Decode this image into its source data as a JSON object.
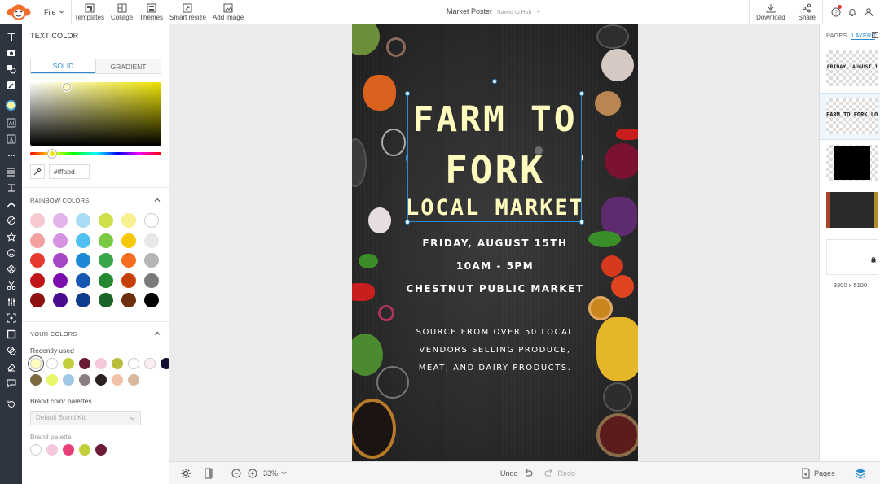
{
  "app": {
    "file_menu": "File",
    "toolbar": [
      {
        "name": "templates",
        "label": "Templates"
      },
      {
        "name": "collage",
        "label": "Collage"
      },
      {
        "name": "themes",
        "label": "Themes"
      },
      {
        "name": "smart-resize",
        "label": "Smart resize"
      },
      {
        "name": "add-image",
        "label": "Add image"
      }
    ],
    "doc_title": "Market Poster",
    "save_status": "Saved to Hub",
    "download_label": "Download",
    "share_label": "Share"
  },
  "color_panel": {
    "title": "TEXT COLOR",
    "tabs": [
      "SOLID",
      "GRADIENT"
    ],
    "active_tab": "SOLID",
    "hex_value": "#fffabd",
    "rainbow_title": "RAINBOW COLORS",
    "rainbow_colors": [
      "#f8c8d0",
      "#e4b2ea",
      "#a9dcf5",
      "#cfe04a",
      "#f6f08f",
      "#ffffff",
      "#f2a0a0",
      "#d393e0",
      "#4fc0f0",
      "#7ac943",
      "#f5c800",
      "#e8e8e8",
      "#e63b2e",
      "#a648c6",
      "#1e88d8",
      "#3aa64a",
      "#f56d20",
      "#b5b5b5",
      "#c0161a",
      "#7a0dab",
      "#1757b2",
      "#23882f",
      "#c44008",
      "#7a7a7a",
      "#8c1212",
      "#4a0b8e",
      "#0f3c8c",
      "#1a6428",
      "#6e2d0c",
      "#000000"
    ],
    "your_colors_title": "YOUR COLORS",
    "recently_used_label": "Recently used",
    "recent_colors": [
      "#fffabd",
      "#ffffff",
      "#c2cf3a",
      "#6b1b33",
      "#f5c6dc",
      "#b8bd3b",
      "#ffffff",
      "#fdeef6",
      "#101030",
      "#7a6a3e",
      "#e9f56a",
      "#9fc8e6",
      "#8c7e80",
      "#2a2220",
      "#f3c0a8",
      "#d8b9a0"
    ],
    "brand_palettes_label": "Brand color palettes",
    "brand_kit_placeholder": "Default Brand Kit",
    "brand_palette_label": "Brand palette",
    "brand_colors": [
      "#ffffff",
      "#f5c6dc",
      "#e83e7a",
      "#c2cf3a",
      "#6b1b33"
    ]
  },
  "poster": {
    "title_line1": "FARM TO",
    "title_line2": "FORK",
    "title_line3": "LOCAL MARKET",
    "date": "FRIDAY, AUGUST 15TH",
    "time": "10AM - 5PM",
    "venue": "CHESTNUT PUBLIC MARKET",
    "desc_line1": "SOURCE FROM OVER 50 LOCAL",
    "desc_line2": "VENDORS SELLING PRODUCE,",
    "desc_line3": "MEAT, AND DAIRY PRODUCTS.",
    "title_color": "#fffabd"
  },
  "bottom_bar": {
    "zoom": "33%",
    "undo_label": "Undo",
    "redo_label": "Redo",
    "pages_label": "Pages"
  },
  "right_panel": {
    "tabs": [
      "PAGES",
      "LAYERS"
    ],
    "active_tab": "LAYERS",
    "layers": [
      {
        "label": "FRIDAY, AUGUST 1"
      },
      {
        "label": "FARM TO FORK LOC"
      }
    ],
    "canvas_size": "3300 x 5100"
  }
}
